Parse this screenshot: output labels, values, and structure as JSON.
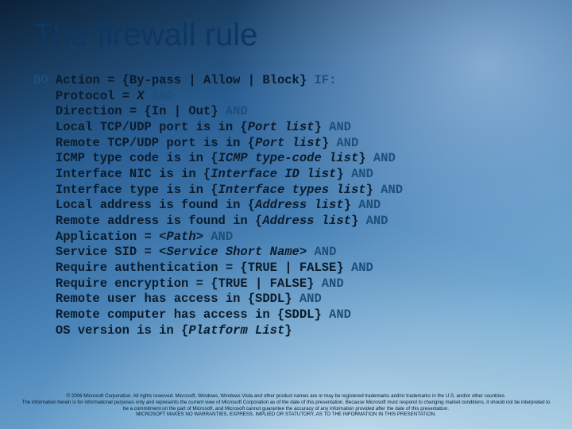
{
  "slide": {
    "title": "The firewall rule",
    "code": {
      "do": "DO",
      "if": "IF:",
      "and": "AND",
      "line_action_a": " Action = {By-pass | Allow | Block} ",
      "line_proto": "Protocol = ",
      "line_proto_var": "X",
      "line_dir": "Direction = {In | Out} ",
      "line_local_port_a": "Local TCP/UDP port is in {",
      "line_local_port_var": "Port list",
      "line_local_port_b": "} ",
      "line_remote_port_a": "Remote TCP/UDP port is in {",
      "line_remote_port_var": "Port list",
      "line_remote_port_b": "} ",
      "line_icmp_a": "ICMP type code is in {",
      "line_icmp_var": "ICMP type-code list",
      "line_icmp_b": "} ",
      "line_nic_a": "Interface NIC is in {",
      "line_nic_var": "Interface ID list",
      "line_nic_b": "} ",
      "line_iftype_a": "Interface type is in {",
      "line_iftype_var": "Interface types list",
      "line_iftype_b": "} ",
      "line_laddr_a": "Local address is found in {",
      "line_laddr_var": "Address list",
      "line_laddr_b": "} ",
      "line_raddr_a": "Remote address is found in {",
      "line_raddr_var": "Address list",
      "line_raddr_b": "} ",
      "line_app_a": "Application = <",
      "line_app_var": "Path",
      "line_app_b": "> ",
      "line_svc_a": "Service SID = <",
      "line_svc_var": "Service Short Name",
      "line_svc_b": "> ",
      "line_auth": "Require authentication = {TRUE | FALSE} ",
      "line_enc": "Require encryption = {TRUE | FALSE} ",
      "line_ruser": "Remote user has access in {SDDL} ",
      "line_rcomp": "Remote computer has access in {SDDL} ",
      "line_os_a": "OS version is in {",
      "line_os_var": "Platform List",
      "line_os_b": "}"
    },
    "footer": {
      "l1": "© 2006 Microsoft Corporation. All rights reserved. Microsoft, Windows, Windows Vista and other product names are or may be registered trademarks and/or trademarks in the U.S. and/or other countries.",
      "l2": "The information herein is for informational purposes only and represents the current view of Microsoft Corporation as of the date of this presentation.  Because Microsoft must respond to changing market conditions, it should not be interpreted to be a commitment on the part of Microsoft, and Microsoft cannot guarantee the accuracy of any information provided after the date of this presentation.",
      "l3": "MICROSOFT MAKES NO WARRANTIES, EXPRESS, IMPLIED OR STATUTORY, AS TO THE INFORMATION IN THIS PRESENTATION."
    }
  }
}
